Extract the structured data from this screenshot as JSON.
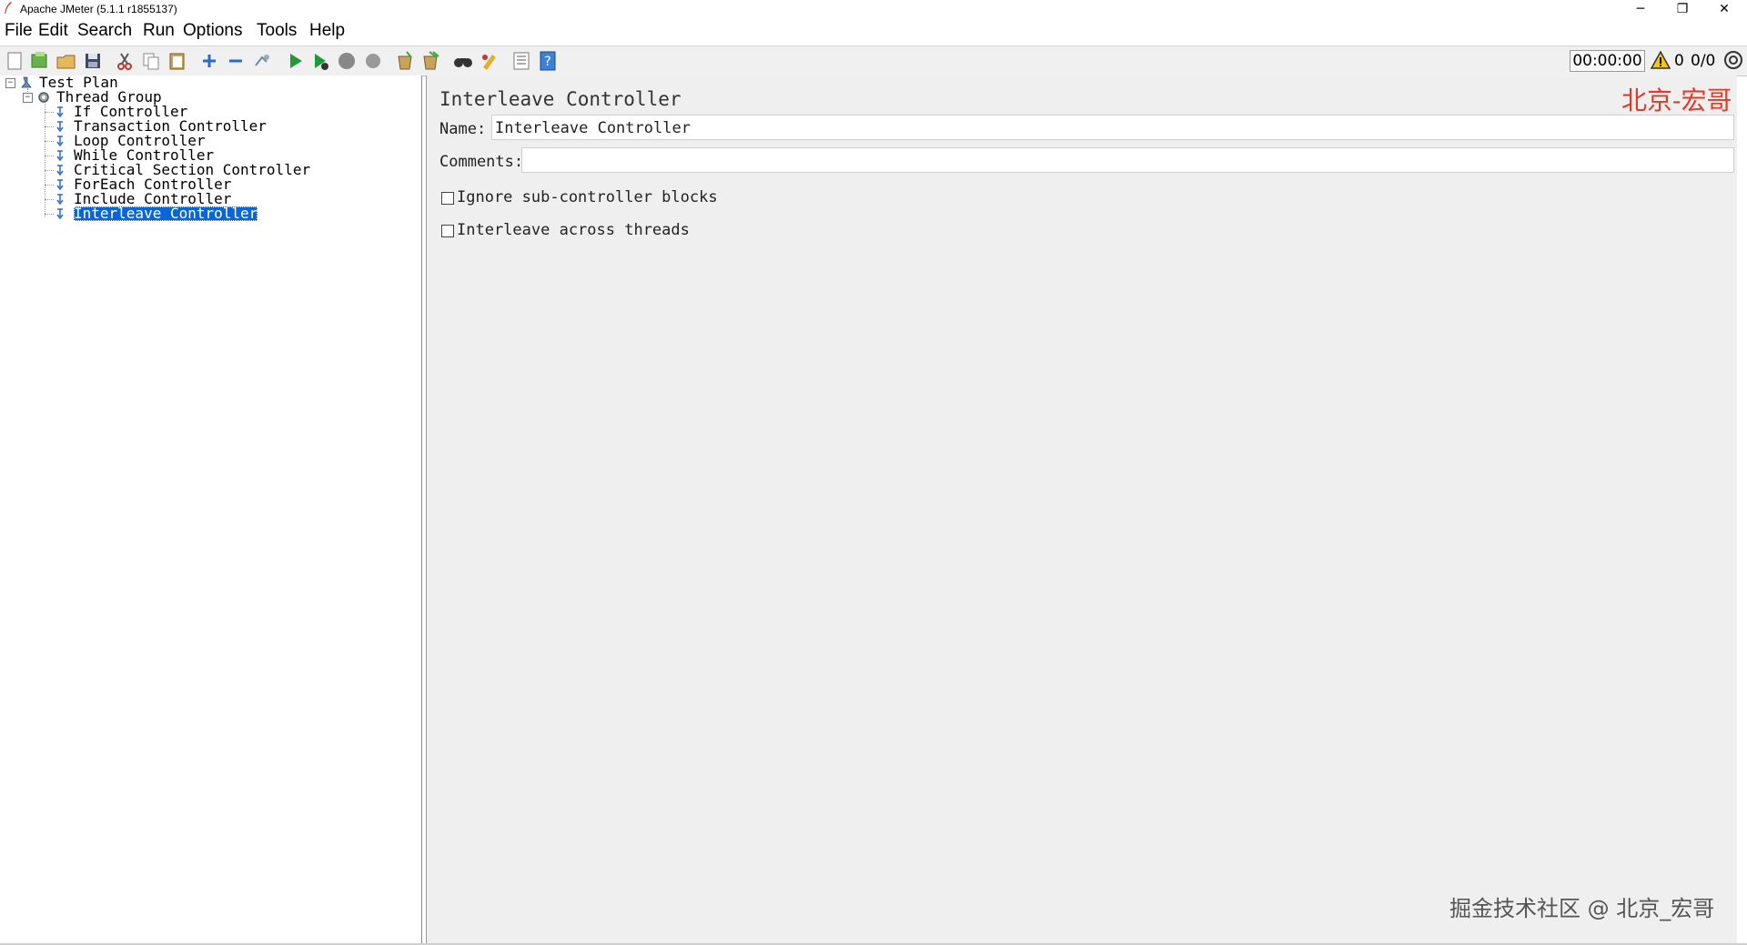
{
  "window": {
    "title": "Apache JMeter (5.1.1 r1855137)",
    "minimize": "─",
    "restore": "❐",
    "close": "✕"
  },
  "menu": {
    "items": [
      {
        "label": "File"
      },
      {
        "label": "Edit"
      },
      {
        "label": "Search"
      },
      {
        "label": "Run"
      },
      {
        "label": "Options"
      },
      {
        "label": "Tools"
      },
      {
        "label": "Help"
      }
    ]
  },
  "toolbar": {
    "icons": [
      "new-icon",
      "templates-icon",
      "open-icon",
      "save-icon",
      "cut-icon",
      "copy-icon",
      "paste-icon",
      "expand-icon",
      "collapse-icon",
      "toggle-icon",
      "start-icon",
      "start-no-pause-icon",
      "stop-icon",
      "shutdown-icon",
      "clear-icon",
      "clear-all-icon",
      "search-icon",
      "reset-search-icon",
      "function-helper-icon",
      "help-icon"
    ],
    "timer": "00:00:00",
    "warning_count": "0",
    "threads": "0/0"
  },
  "tree": {
    "root": {
      "label": "Test Plan"
    },
    "thread_group": {
      "label": "Thread Group"
    },
    "children": [
      {
        "label": "If Controller"
      },
      {
        "label": "Transaction Controller"
      },
      {
        "label": "Loop Controller"
      },
      {
        "label": "While Controller"
      },
      {
        "label": "Critical Section Controller"
      },
      {
        "label": "ForEach Controller"
      },
      {
        "label": "Include Controller"
      },
      {
        "label": "Interleave Controller",
        "selected": true
      }
    ]
  },
  "panel": {
    "title": "Interleave Controller",
    "watermark_top": "北京-宏哥",
    "name_label": "Name:",
    "name_value": "Interleave Controller",
    "comments_label": "Comments:",
    "comments_value": "",
    "checkbox_ignore": {
      "label": "Ignore sub-controller blocks",
      "checked": false
    },
    "checkbox_interleave": {
      "label": "Interleave across threads",
      "checked": false
    },
    "watermark_bottom": "掘金技术社区 @ 北京_宏哥"
  },
  "colors": {
    "selection": "#0a66d6",
    "watermark_red": "#e23a2a",
    "panel_bg": "#efefef"
  }
}
